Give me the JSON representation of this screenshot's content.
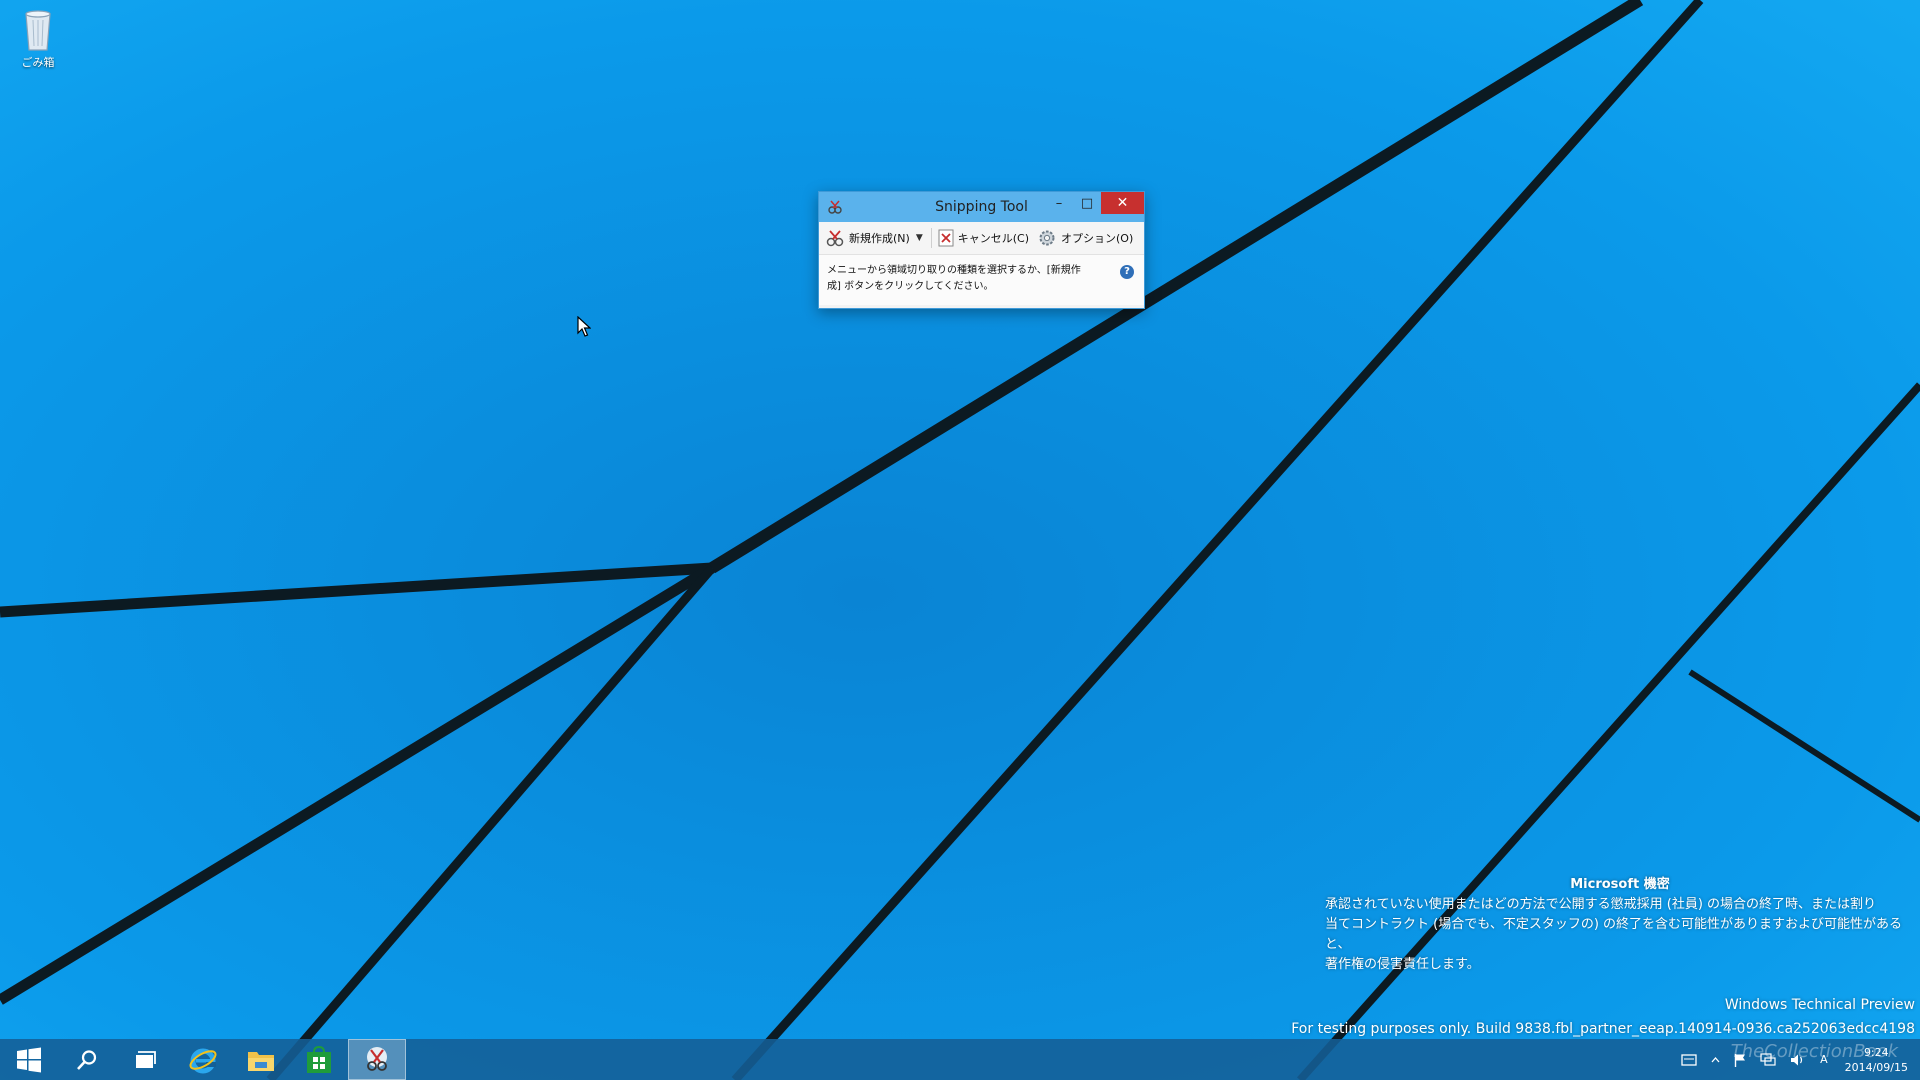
{
  "desktop": {
    "recycle_bin_label": "ごみ箱"
  },
  "snipping_tool": {
    "title": "Snipping Tool",
    "minimize": "–",
    "maximize": "□",
    "close": "✕",
    "toolbar": {
      "new_label": "新規作成(N)",
      "cancel_label": "キャンセル(C)",
      "options_label": "オプション(O)"
    },
    "message_line1": "メニューから領域切り取りの種類を選択するか、[新規作",
    "message_line2": "成] ボタンをクリックしてください。",
    "help": "?"
  },
  "watermark": {
    "title": "Microsoft 機密",
    "line1": "承認されていない使用またはどの方法で公開する懲戒採用 (社員) の場合の終了時、または割り",
    "line2": "当てコントラクト (場合でも、不定スタッフの) の終了を含む可能性がありますおよび可能性があると、",
    "line3": "著作権の侵害責任します。"
  },
  "build_info": {
    "edition": "Windows Technical Preview",
    "build": "For testing purposes only. Build 9838.fbl_partner_eeap.140914-0936.ca252063edcc4198"
  },
  "taskbar": {
    "ime_indicator": "A",
    "clock_time": "9:24",
    "clock_date": "2014/09/15",
    "logo_watermark": "TheCollectionBook"
  },
  "colors": {
    "wallpaper": "#0a8fe0",
    "title_bar": "#5ab2ec",
    "close_button": "#c7302f",
    "taskbar": "#145f96"
  }
}
